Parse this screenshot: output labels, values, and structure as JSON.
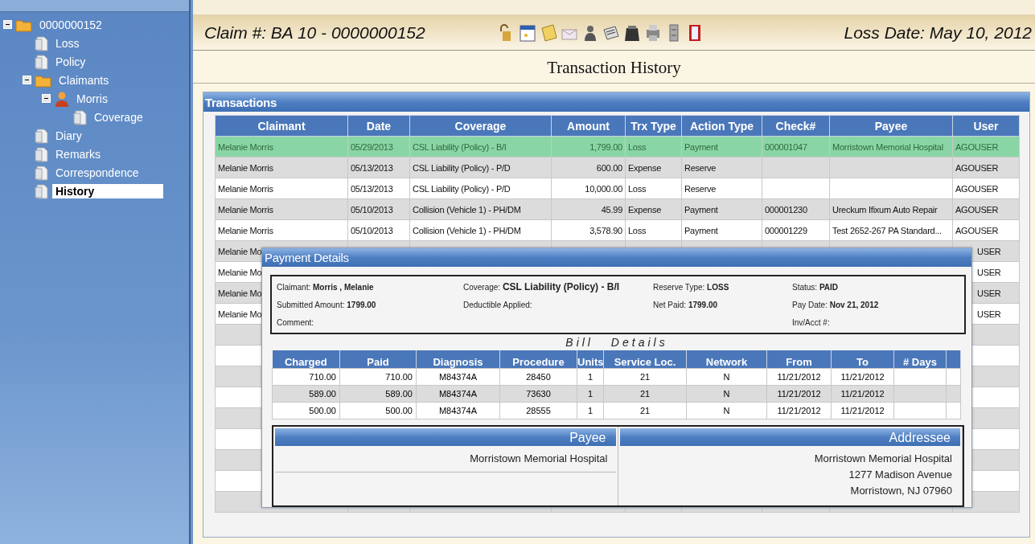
{
  "tree": [
    {
      "label": "0000000152",
      "kind": "folder",
      "expanded": true,
      "selected": false,
      "children": [
        {
          "label": "Loss",
          "kind": "document",
          "selected": false
        },
        {
          "label": "Policy",
          "kind": "document",
          "selected": false
        },
        {
          "label": "Claimants",
          "kind": "folder",
          "expanded": true,
          "selected": false,
          "children": [
            {
              "label": "Morris",
              "kind": "person",
              "expanded": true,
              "selected": false,
              "children": [
                {
                  "label": "Coverage",
                  "kind": "document",
                  "selected": false
                }
              ]
            }
          ]
        },
        {
          "label": "Diary",
          "kind": "document",
          "selected": false
        },
        {
          "label": "Remarks",
          "kind": "document",
          "selected": false
        },
        {
          "label": "Correspondence",
          "kind": "document",
          "selected": false
        },
        {
          "label": "History",
          "kind": "document",
          "selected": true
        }
      ]
    }
  ],
  "header": {
    "claim": "Claim #: BA 10 - 0000000152",
    "loss_date": "Loss Date: May 10, 2012"
  },
  "page_title": "Transaction History",
  "transactions": {
    "title": "Transactions",
    "columns": [
      "Claimant",
      "Date",
      "Coverage",
      "Amount",
      "Trx Type",
      "Action Type",
      "Check#",
      "Payee",
      "User"
    ],
    "rows": [
      {
        "selected": true,
        "cells": [
          "Melanie Morris",
          "05/29/2013",
          "CSL Liability (Policy) - B/I",
          "1,799.00",
          "Loss",
          "Payment",
          "000001047",
          "Morristown Memorial Hospital",
          "AGOUSER"
        ]
      },
      {
        "selected": false,
        "cells": [
          "Melanie Morris",
          "05/13/2013",
          "CSL Liability (Policy) - P/D",
          "600.00",
          "Expense",
          "Reserve",
          "",
          "",
          "AGOUSER"
        ]
      },
      {
        "selected": false,
        "cells": [
          "Melanie Morris",
          "05/13/2013",
          "CSL Liability (Policy) - P/D",
          "10,000.00",
          "Loss",
          "Reserve",
          "",
          "",
          "AGOUSER"
        ]
      },
      {
        "selected": false,
        "cells": [
          "Melanie Morris",
          "05/10/2013",
          "Collision (Vehicle 1) - PH/DM",
          "45.99",
          "Expense",
          "Payment",
          "000001230",
          "Ureckum Ifixum Auto Repair",
          "AGOUSER"
        ]
      },
      {
        "selected": false,
        "cells": [
          "Melanie Morris",
          "05/10/2013",
          "Collision (Vehicle 1) - PH/DM",
          "3,578.90",
          "Loss",
          "Payment",
          "000001229",
          "Test 2652-267 PA Standard...",
          "AGOUSER"
        ]
      },
      {
        "selected": false,
        "cells": [
          "Melanie Mo",
          "",
          "",
          "",
          "",
          "",
          "",
          "",
          "USER"
        ]
      },
      {
        "selected": false,
        "cells": [
          "Melanie Mo",
          "",
          "",
          "",
          "",
          "",
          "",
          "",
          "USER"
        ]
      },
      {
        "selected": false,
        "cells": [
          "Melanie Mo",
          "",
          "",
          "",
          "",
          "",
          "",
          "",
          "USER"
        ]
      },
      {
        "selected": false,
        "cells": [
          "Melanie Mo",
          "",
          "",
          "",
          "",
          "",
          "",
          "",
          "USER"
        ]
      }
    ]
  },
  "payment_details": {
    "title": "Payment Details",
    "field_columns": [
      [
        {
          "label": "Claimant:",
          "value": "Morris , Melanie"
        },
        {
          "label": "Submitted Amount:",
          "value": "1799.00"
        },
        {
          "label": "Comment:"
        }
      ],
      [
        {
          "label": "Coverage:",
          "value": "CSL Liability (Policy) - B/I"
        },
        {
          "label": "Deductible Applied:"
        }
      ],
      [
        {
          "label": "Reserve Type:",
          "value": "LOSS"
        },
        {
          "label": "Net Paid:",
          "value": "1799.00"
        }
      ],
      [
        {
          "label": "Status:",
          "value": "PAID"
        },
        {
          "label": "Pay Date:",
          "value": "Nov 21, 2012"
        },
        {
          "label": "Inv/Acct #:"
        }
      ]
    ],
    "bill_title": "Bill Details",
    "bill_columns": [
      "Charged",
      "Paid",
      "Diagnosis",
      "Procedure",
      "Units",
      "Service Loc.",
      "Network",
      "From",
      "To",
      "# Days"
    ],
    "bill_rows": [
      [
        "710.00",
        "710.00",
        "M84374A",
        "28450",
        "1",
        "21",
        "N",
        "11/21/2012",
        "11/21/2012",
        ""
      ],
      [
        "589.00",
        "589.00",
        "M84374A",
        "73630",
        "1",
        "21",
        "N",
        "11/21/2012",
        "11/21/2012",
        ""
      ],
      [
        "500.00",
        "500.00",
        "M84374A",
        "28555",
        "1",
        "21",
        "N",
        "11/21/2012",
        "11/21/2012",
        ""
      ]
    ],
    "payee": {
      "title": "Payee",
      "lines": [
        "Morristown Memorial Hospital"
      ]
    },
    "addressee": {
      "title": "Addressee",
      "lines": [
        "Morristown Memorial Hospital",
        "1277 Madison Avenue",
        "Morristown, NJ 07960"
      ]
    }
  }
}
